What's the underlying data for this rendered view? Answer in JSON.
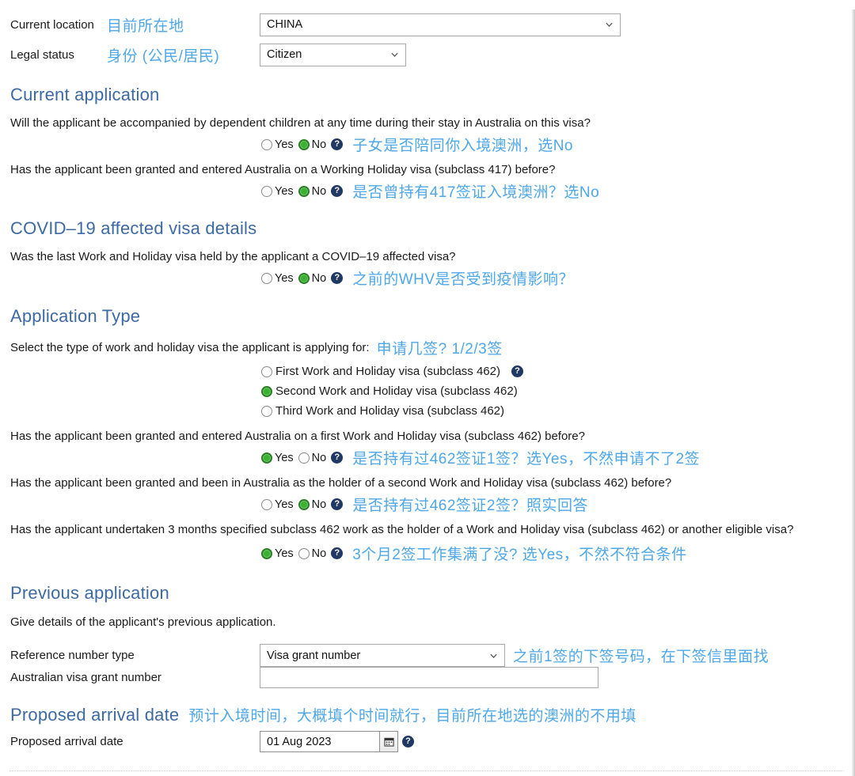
{
  "top_fields": [
    {
      "label": "Current location",
      "annotation": "目前所在地",
      "value": "CHINA",
      "caret": "chevron-down-icon"
    },
    {
      "label": "Legal status",
      "annotation": "身份 (公民/居民)",
      "value": "Citizen",
      "caret": "chevron-down-icon"
    }
  ],
  "sections": {
    "current_application": {
      "heading": "Current application",
      "questions": [
        {
          "text": "Will the applicant be accompanied by dependent children at any time during their stay in Australia on this visa?",
          "yes_label": "Yes",
          "no_label": "No",
          "selected": "No",
          "help": "help-icon",
          "annotation": "子女是否陪同你入境澳洲，选No"
        },
        {
          "text": "Has the applicant been granted and entered Australia on a Working Holiday visa (subclass 417) before?",
          "yes_label": "Yes",
          "no_label": "No",
          "selected": "No",
          "help": "help-icon",
          "annotation": "是否曾持有417签证入境澳洲？选No"
        }
      ]
    },
    "covid": {
      "heading": "COVID–19 affected visa details",
      "questions": [
        {
          "text": "Was the last Work and Holiday visa held by the applicant a COVID–19 affected visa?",
          "yes_label": "Yes",
          "no_label": "No",
          "selected": "No",
          "help": "help-icon",
          "annotation": "之前的WHV是否受到疫情影响？"
        }
      ]
    },
    "application_type": {
      "heading": "Application Type",
      "prompt": "Select the type of work and holiday visa the applicant is applying for:",
      "prompt_annotation": "申请几签? 1/2/3签",
      "options": [
        {
          "label": "First Work and Holiday visa (subclass 462)",
          "selected": false,
          "help": "help-icon"
        },
        {
          "label": "Second Work and Holiday visa (subclass 462)",
          "selected": true,
          "help": null
        },
        {
          "label": "Third Work and Holiday visa (subclass 462)",
          "selected": false,
          "help": null
        }
      ],
      "questions": [
        {
          "text": "Has the applicant been granted and entered Australia on a first Work and Holiday visa (subclass 462) before?",
          "yes_label": "Yes",
          "no_label": "No",
          "selected": "Yes",
          "help": "help-icon",
          "annotation": "是否持有过462签证1签？选Yes，不然申请不了2签"
        },
        {
          "text": "Has the applicant been granted and been in Australia as the holder of a second Work and Holiday visa (subclass 462) before?",
          "yes_label": "Yes",
          "no_label": "No",
          "selected": "No",
          "help": "help-icon",
          "annotation": "是否持有过462签证2签？照实回答"
        },
        {
          "text": "Has the applicant undertaken 3 months specified subclass 462 work as the holder of a Work and Holiday visa (subclass 462) or another eligible visa?",
          "yes_label": "Yes",
          "no_label": "No",
          "selected": "Yes",
          "help": "help-icon",
          "annotation": "3个月2签工作集满了没? 选Yes，不然不符合条件"
        }
      ]
    },
    "previous_application": {
      "heading": "Previous application",
      "intro": "Give details of the applicant's previous application.",
      "reference_type_label": "Reference number type",
      "reference_type_value": "Visa grant number",
      "reference_type_caret": "chevron-down-icon",
      "reference_type_annotation": "之前1签的下签号码，在下签信里面找",
      "grant_number_label": "Australian visa grant number",
      "grant_number_value": ""
    },
    "arrival": {
      "heading": "Proposed arrival date",
      "heading_annotation": "预计入境时间，大概填个时间就行，目前所在地选的澳洲的不用填",
      "label": "Proposed arrival date",
      "value": "01 Aug 2023",
      "calendar_icon": "calendar-icon",
      "help": "help-icon"
    }
  },
  "colors": {
    "heading_blue": "#3d6aa3",
    "annotation_blue": "#4ea7e8",
    "radio_selected_green": "#3cb034",
    "help_icon_navy": "#1f3864"
  }
}
